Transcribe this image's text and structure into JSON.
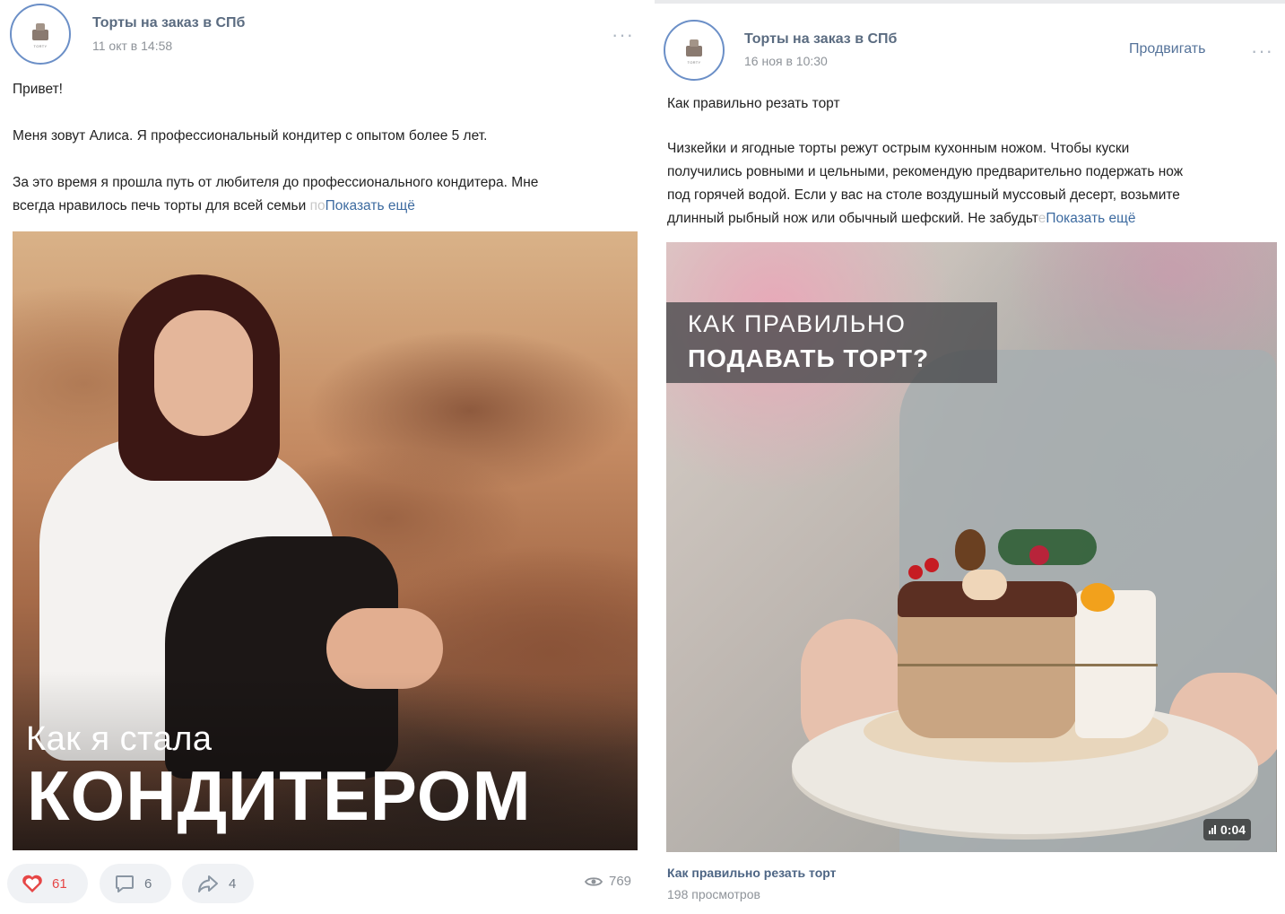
{
  "post1": {
    "group_name": "Торты на заказ в СПб",
    "date": "11 окт в 14:58",
    "more": "···",
    "text": {
      "p1": "Привет!",
      "p2": "Меня зовут Алиса. Я профессиональный кондитер с опытом более 5 лет.",
      "p3_line1": "За это время я прошла путь от любителя до профессионального кондитера. Мне",
      "p3_line2": "всегда нравилось печь торты для всей семьи ",
      "p3_fade": "по",
      "show_more": "Показать ещё"
    },
    "photo": {
      "overlay_small": "Как я стала",
      "overlay_big": "КОНДИТЕРОМ"
    },
    "actions": {
      "likes": "61",
      "comments": "6",
      "shares": "4",
      "views": "769"
    },
    "colors": {
      "like": "#e64646",
      "link": "#3d6ba0"
    }
  },
  "post2": {
    "group_name": "Торты на заказ в СПб",
    "date": "16 ноя в 10:30",
    "promote": "Продвигать",
    "more": "···",
    "text": {
      "p1": "Как правильно резать торт",
      "p2_line1": "Чизкейки и ягодные торты режут острым кухонным ножом. Чтобы куски",
      "p2_line2": "получились ровными и цельными, рекомендую предварительно подержать нож",
      "p2_line3": "под горячей водой. Если у вас на столе воздушный муссовый десерт, возьмите",
      "p2_line4": "длинный рыбный нож или обычный шефский. Не забудьт",
      "p2_fade": "е",
      "show_more": "Показать ещё"
    },
    "video": {
      "title_line1": "КАК ПРАВИЛЬНО",
      "title_line2": "ПОДАВАТЬ ТОРТ?",
      "duration": "0:04",
      "caption": "Как правильно резать торт",
      "views": "198 просмотров"
    }
  },
  "icons": {
    "avatar": "cake-logo",
    "like": "heart-icon",
    "comment": "comment-icon",
    "share": "share-icon",
    "views": "eye-icon",
    "more": "more-dots-icon",
    "sound": "sound-bars-icon"
  }
}
